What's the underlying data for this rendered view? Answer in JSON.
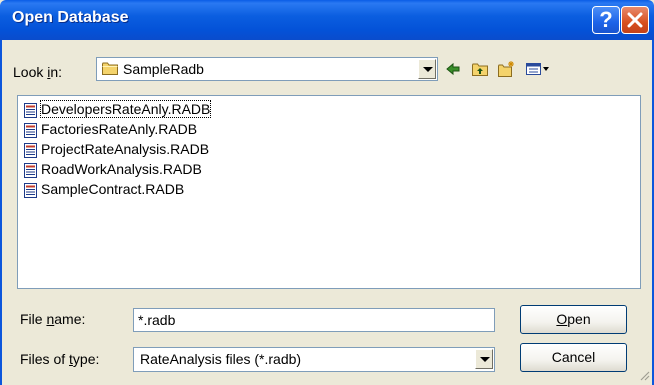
{
  "window": {
    "title": "Open Database"
  },
  "lookin": {
    "label_pre": "Look ",
    "label_key": "i",
    "label_post": "n:",
    "value": "SampleRadb"
  },
  "toolbar": {
    "icons": [
      "back-icon",
      "up-folder-icon",
      "new-folder-icon",
      "views-menu-icon"
    ]
  },
  "files": [
    {
      "name": "DevelopersRateAnly.RADB",
      "selected": true
    },
    {
      "name": "FactoriesRateAnly.RADB",
      "selected": false
    },
    {
      "name": "ProjectRateAnalysis.RADB",
      "selected": false
    },
    {
      "name": "RoadWorkAnalysis.RADB",
      "selected": false
    },
    {
      "name": "SampleContract.RADB",
      "selected": false
    }
  ],
  "filename": {
    "label_pre": "File ",
    "label_key": "n",
    "label_post": "ame:",
    "value": "*.radb"
  },
  "filetype": {
    "label_pre": "Files of ",
    "label_key": "t",
    "label_post": "ype:",
    "value": "RateAnalysis files (*.radb)"
  },
  "buttons": {
    "open_key": "O",
    "open_rest": "pen",
    "cancel": "Cancel"
  },
  "colors": {
    "titlebar": "#0452d8",
    "face": "#ece9d8",
    "border": "#7f9db9",
    "close": "#d8501f"
  }
}
